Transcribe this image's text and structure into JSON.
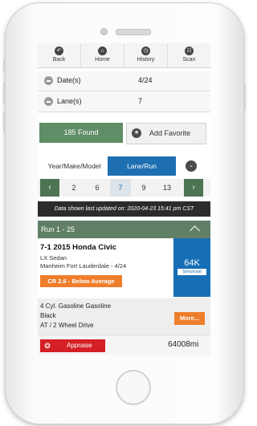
{
  "toolbar": {
    "items": [
      {
        "label": "Back",
        "icon": "back-arrow-icon"
      },
      {
        "label": "Home",
        "icon": "home-icon"
      },
      {
        "label": "History",
        "icon": "history-clock-icon"
      },
      {
        "label": "Scan",
        "icon": "barcode-scan-icon"
      }
    ]
  },
  "filters": {
    "dates": {
      "label": "Date(s)",
      "value": "4/24"
    },
    "lanes": {
      "label": "Lane(s)",
      "value": "7"
    }
  },
  "actions": {
    "found": "185 Found",
    "favorite": "Add Favorite"
  },
  "sort": {
    "year_make_model": "Year/Make/Model",
    "lane_run": "Lane/Run",
    "selected": "Lane/Run"
  },
  "lanes": {
    "numbers": [
      "2",
      "6",
      "7",
      "9",
      "13"
    ],
    "active": "7"
  },
  "updated": "Data shown last updated on: 2020-04-23 15:41 pm CST",
  "run_group": {
    "title": "Run 1 - 25"
  },
  "vehicle": {
    "title": "7-1 2015 Honda Civic",
    "trim": "LX Sedan",
    "location": "Manheim Fort Lauderdale - 4/24",
    "condition": "CR 2.6 - Below Average",
    "mileage_short": "64K",
    "simulcast": "Simulcast",
    "engine": "4 Cyl. Gasoline  Gasoline",
    "color": "Black",
    "drivetrain": "AT / 2 Wheel Drive",
    "more": "More...",
    "appraise": "Appraise",
    "odometer": "64008mi"
  },
  "colors": {
    "green": "#5f8d66",
    "blue": "#1e6fb1",
    "orange": "#ef7e2c",
    "red": "#d51f26",
    "dark": "#2c2c2c"
  }
}
